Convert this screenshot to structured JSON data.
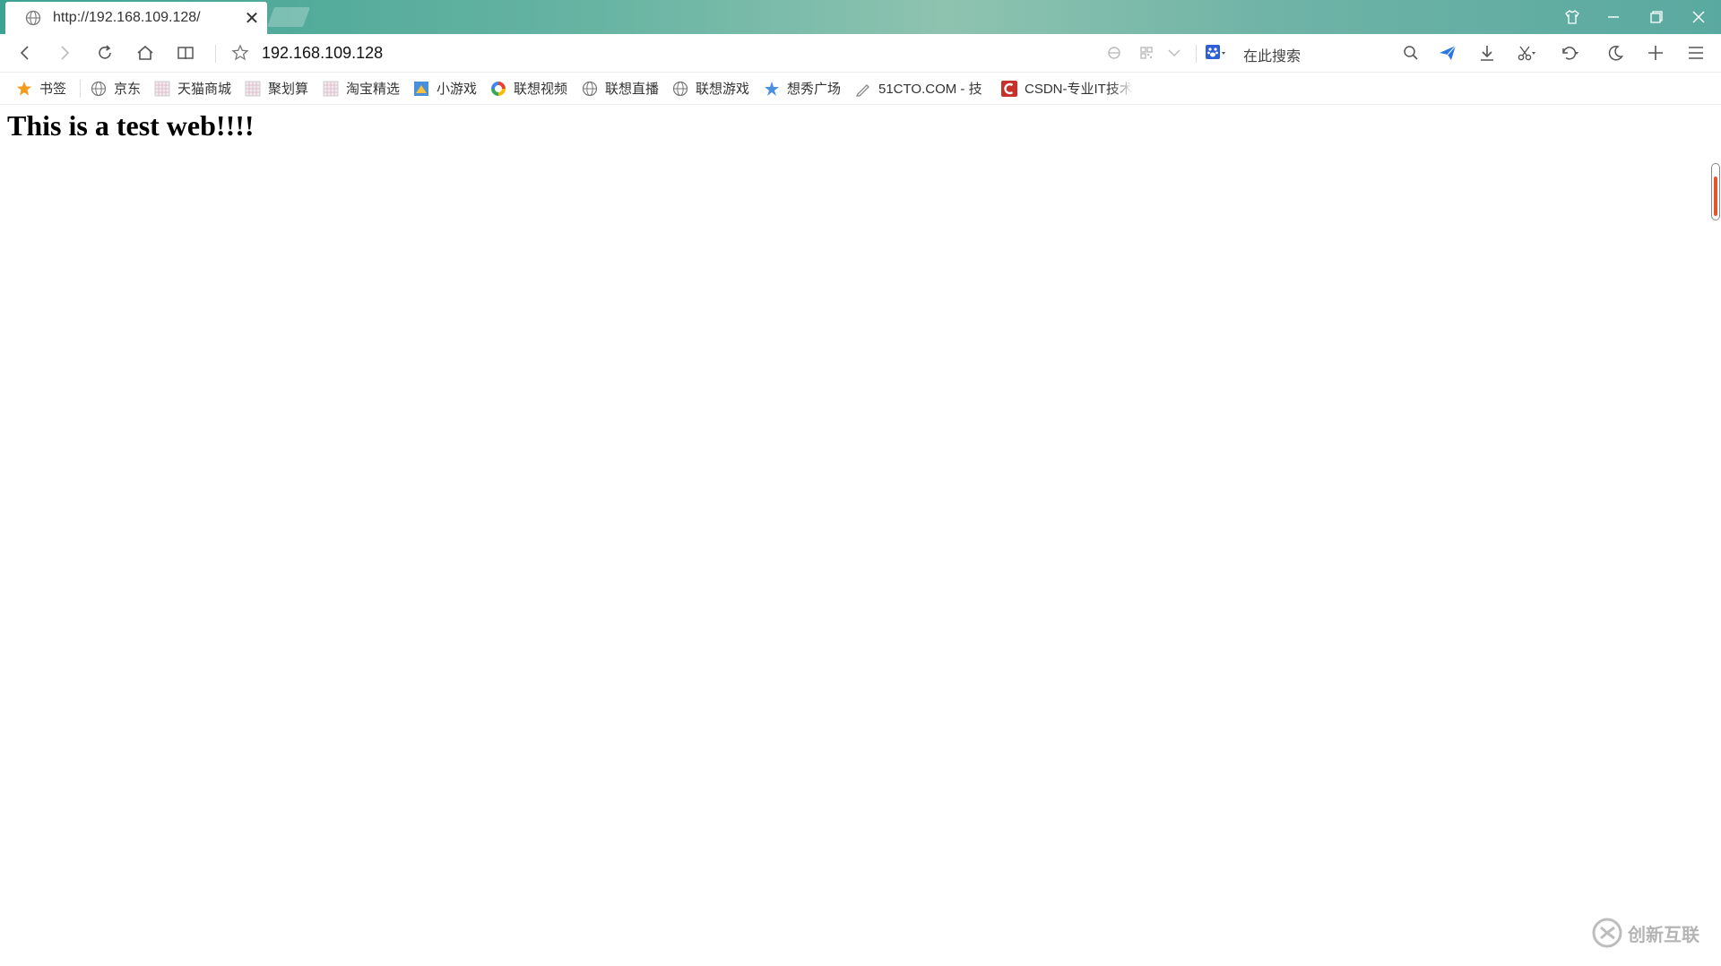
{
  "tab": {
    "title": "http://192.168.109.128/",
    "close_glyph": "✕"
  },
  "address": {
    "url": "192.168.109.128"
  },
  "search": {
    "placeholder": "在此搜索"
  },
  "bookmarks": [
    {
      "label": "书签",
      "icon": "star-icon"
    },
    {
      "label": "京东",
      "icon": "globe-icon"
    },
    {
      "label": "天猫商城",
      "icon": "pixel-favicon-icon"
    },
    {
      "label": "聚划算",
      "icon": "pixel-favicon-icon"
    },
    {
      "label": "淘宝精选",
      "icon": "pixel-favicon-icon"
    },
    {
      "label": "小游戏",
      "icon": "game-icon"
    },
    {
      "label": "联想视频",
      "icon": "color-ring-icon"
    },
    {
      "label": "联想直播",
      "icon": "globe-icon"
    },
    {
      "label": "联想游戏",
      "icon": "globe-icon"
    },
    {
      "label": "想秀广场",
      "icon": "star-burst-icon"
    },
    {
      "label": "51CTO.COM - 技",
      "icon": "pen-icon"
    },
    {
      "label": "CSDN-专业IT技术",
      "icon": "csdn-logo-icon"
    }
  ],
  "page": {
    "heading": "This is a test web!!!!"
  },
  "watermark": {
    "text": "创新互联"
  },
  "colors": {
    "titlebar": "#5aa9a0",
    "accent_send": "#2b78e4",
    "scroll_accent": "#e2562a"
  }
}
